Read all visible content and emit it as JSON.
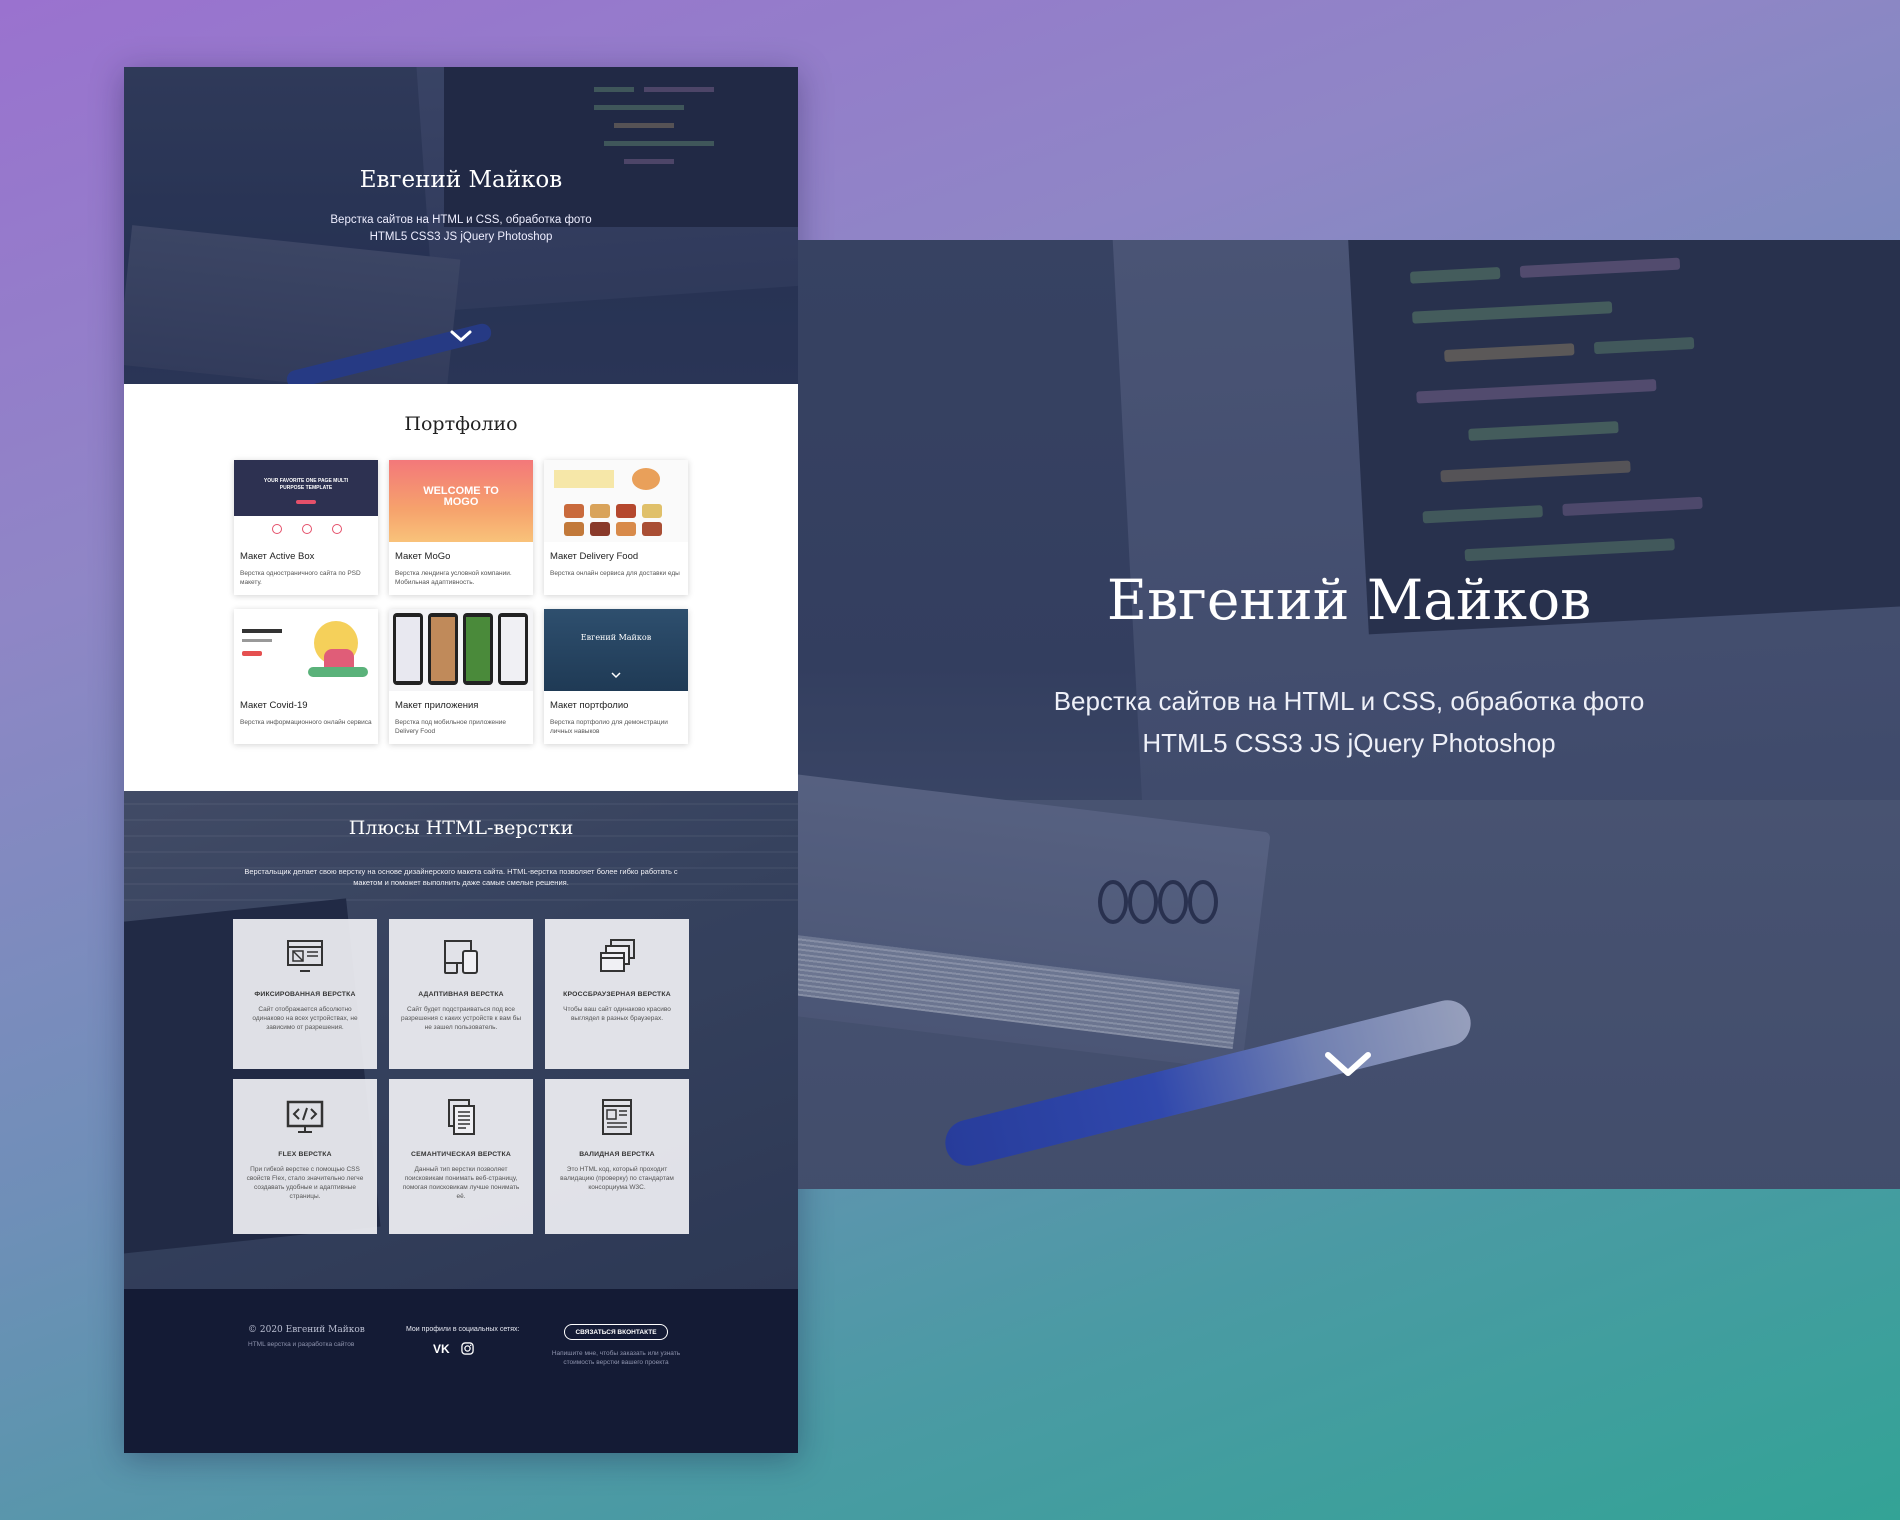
{
  "hero": {
    "name": "Евгений Майков",
    "subtitle_line1": "Верстка сайтов на HTML и CSS, обработка фото",
    "subtitle_line2": "HTML5 CSS3 JS jQuery Photoshop"
  },
  "portfolio": {
    "title": "Портфолио",
    "items": [
      {
        "title": "Макет Active Box",
        "desc": "Верстка одностраничного сайта по PSD макету.",
        "thumb_text": "YOUR FAVORITE ONE PAGE MULTI PURPOSE TEMPLATE"
      },
      {
        "title": "Макет MoGo",
        "desc": "Верстка лендинга условной компании. Мобильная адаптивность.",
        "thumb_text": "WELCOME TO MOGO"
      },
      {
        "title": "Макет Delivery Food",
        "desc": "Верстка онлайн сервиса для доставки еды",
        "thumb_text": ""
      },
      {
        "title": "Макет Covid-19",
        "desc": "Верстка информационного онлайн сервиса",
        "thumb_text": ""
      },
      {
        "title": "Макет приложения",
        "desc": "Верстка под мобильное приложение Delivery Food",
        "thumb_text": ""
      },
      {
        "title": "Макет портфолио",
        "desc": "Верстка портфолио для демонстрации личных навыков",
        "thumb_text": "Евгений Майков"
      }
    ]
  },
  "pluses": {
    "title": "Плюсы HTML-верстки",
    "desc_line1": "Верстальщик делает свою верстку на основе дизайнерского макета сайта. HTML-верстка позволяет более гибко работать с",
    "desc_line2": "макетом и поможет выполнить даже самые смелые решения.",
    "features": [
      {
        "title": "ФИКСИРОВАННАЯ ВЕРСТКА",
        "desc": "Сайт отображается абсолютно одинаково на всех устройствах, не зависимо от разрешения.",
        "icon": "layout-icon"
      },
      {
        "title": "АДАПТИВНАЯ ВЕРСТКА",
        "desc": "Сайт будет подстраиваться под все разрешения с каких устройств к вам бы не зашел пользователь.",
        "icon": "devices-icon"
      },
      {
        "title": "КРОССБРАУЗЕРНАЯ ВЕРСТКА",
        "desc": "Чтобы ваш сайт одинаково красиво выглядел в разных браузерах.",
        "icon": "browser-windows-icon"
      },
      {
        "title": "FLEX ВЕРСТКА",
        "desc": "При гибкой верстке с помощью CSS свойств Flex, стало значительно легче создавать удобные и адаптивные страницы.",
        "icon": "code-monitor-icon"
      },
      {
        "title": "СЕМАНТИЧЕСКАЯ ВЕРСТКА",
        "desc": "Данный тип верстки позволяет поисковикам понимать веб-страницу, помогая поисковикам лучше понимать её.",
        "icon": "documents-icon"
      },
      {
        "title": "ВАЛИДНАЯ ВЕРСТКА",
        "desc": "Это HTML код, который проходит валидацию (проверку) по стандартам консорциума W3C.",
        "icon": "valid-page-icon"
      }
    ]
  },
  "footer": {
    "copyright": "© 2020 Евгений Майков",
    "tagline": "HTML верстка и разработка сайтов",
    "social_label": "Мои профили в социальных сетях:",
    "vk_label": "VK",
    "button_label": "СВЯЗАТЬСЯ ВКОНТАКТЕ",
    "button_note_line1": "Напишите мне, чтобы заказать или узнать",
    "button_note_line2": "стоимость верстки вашего проекта"
  },
  "colors": {
    "footer_bg": "#141b35",
    "accent_pen": "#2c46a6",
    "background_top": "#9a72cf",
    "background_bottom": "#33a396"
  }
}
